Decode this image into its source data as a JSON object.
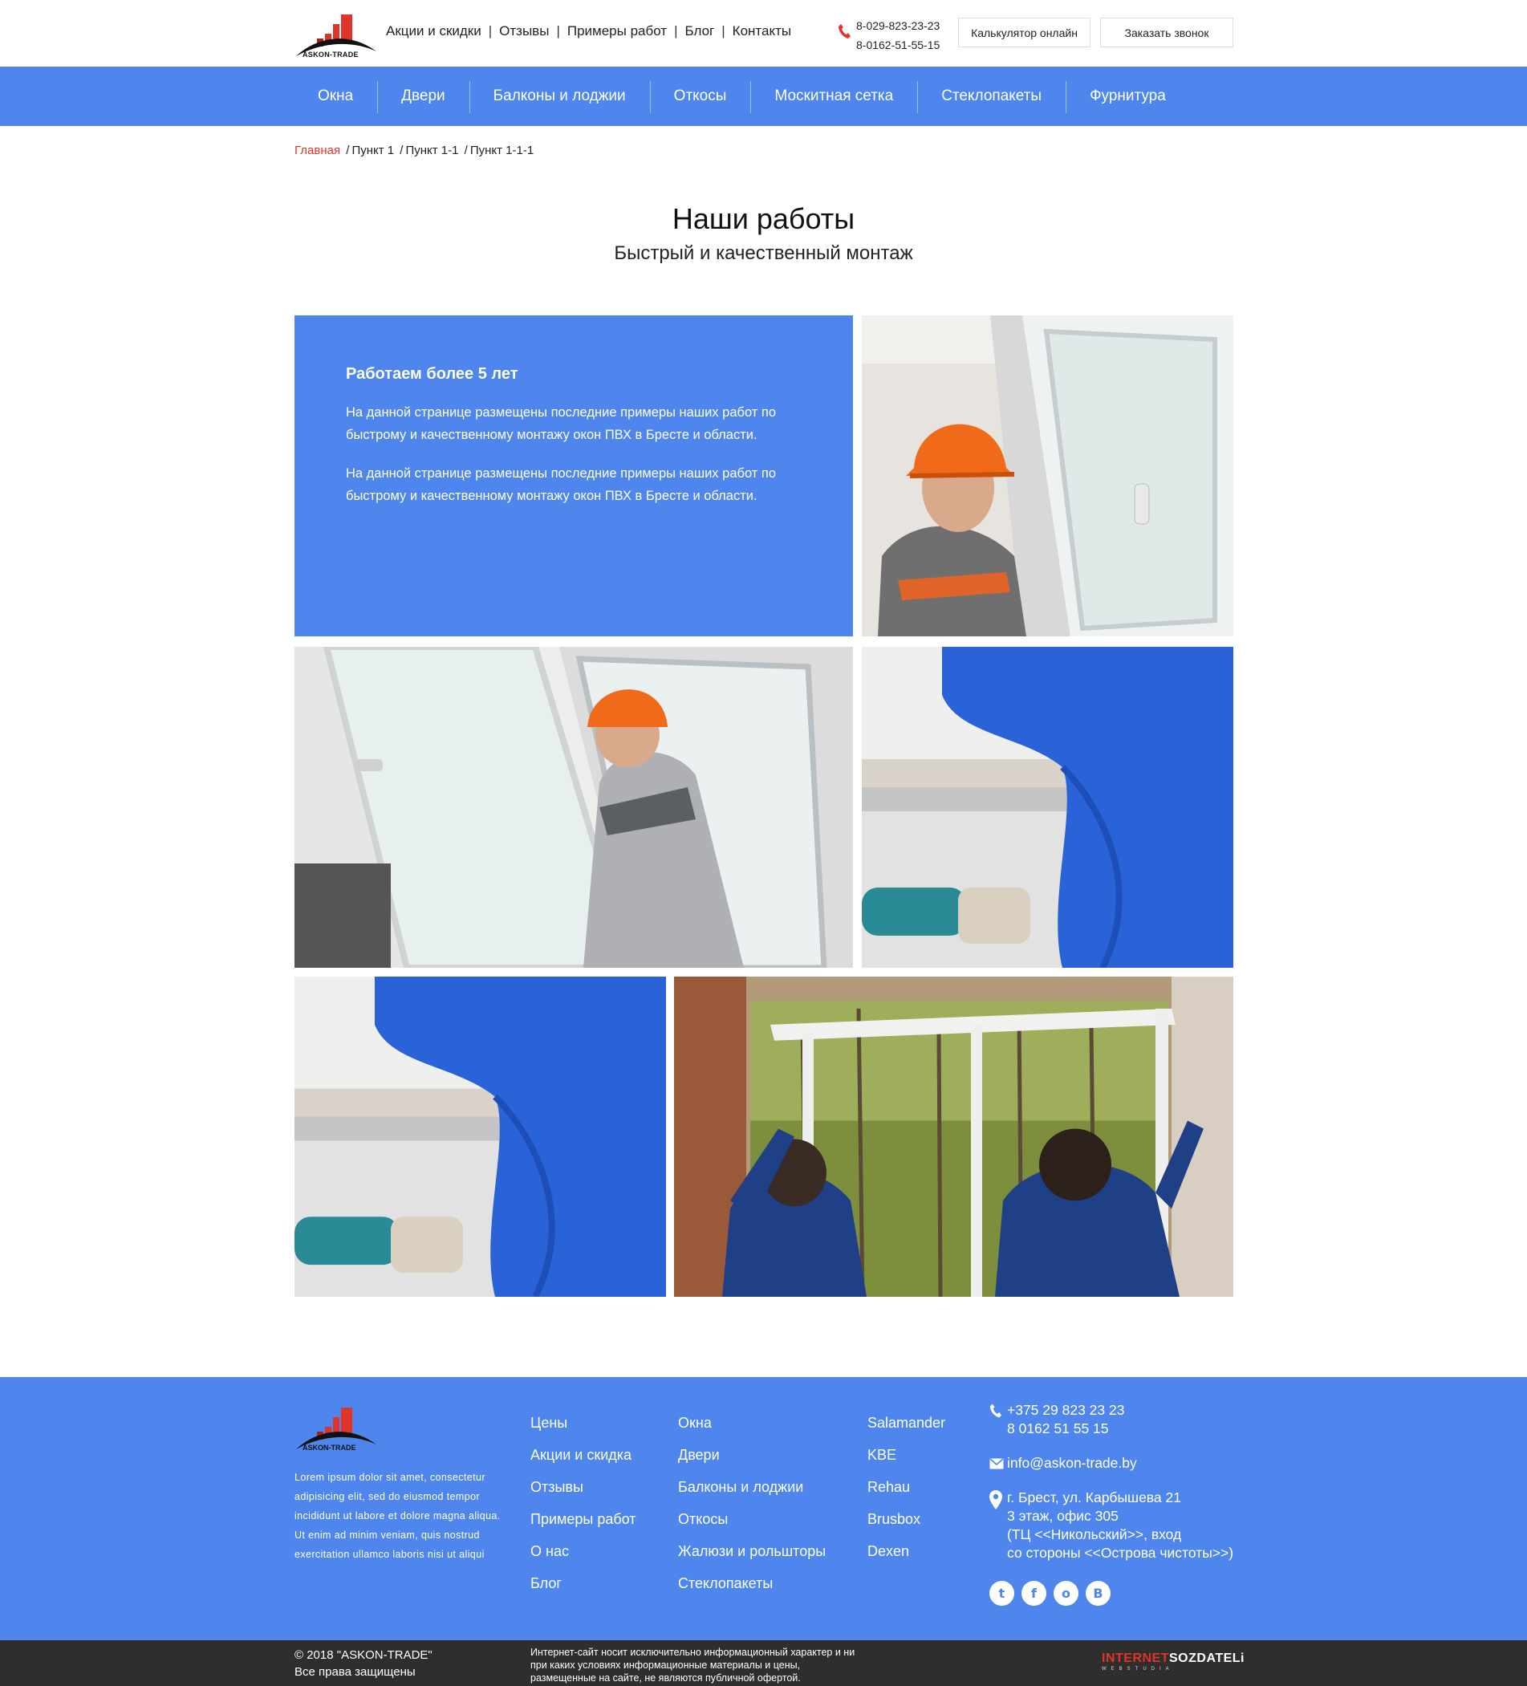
{
  "header": {
    "logo_text": "ASKON-TRADE",
    "topnav": [
      "Акции и скидки",
      "Отзывы",
      "Примеры работ",
      "Блог",
      "Контакты"
    ],
    "phones": [
      "8-029-823-23-23",
      "8-0162-51-55-15"
    ],
    "calc_button": "Калькулятор онлайн",
    "call_button": "Заказать звонок"
  },
  "mainnav": [
    "Окна",
    "Двери",
    "Балконы и лоджии",
    "Откосы",
    "Москитная сетка",
    "Стеклопакеты",
    "Фурнитура"
  ],
  "breadcrumb": {
    "home": "Главная",
    "items": [
      "Пункт 1",
      "Пункт 1-1",
      "Пункт 1-1-1"
    ],
    "separator": "/"
  },
  "page": {
    "title": "Наши работы",
    "subtitle": "Быстрый и качественный монтаж"
  },
  "intro": {
    "heading": "Работаем более 5 лет",
    "paragraphs": [
      "На данной странице размещены последние примеры наших работ по быстрому и качественному монтажу окон ПВХ в Бресте и области.",
      "На данной странице размещены последние примеры наших работ по быстрому и качественному монтажу окон ПВХ в Бресте и области."
    ]
  },
  "footer": {
    "logo_text": "ASKON-TRADE",
    "description": "Lorem ipsum dolor sit amet, consectetur adipisicing elit, sed do eiusmod tempor incididunt ut labore et dolore magna aliqua. Ut enim ad minim veniam, quis nostrud exercitation ullamco laboris nisi ut aliqui",
    "col1": [
      "Цены",
      "Акции и скидка",
      "Отзывы",
      "Примеры работ",
      "О нас",
      "Блог"
    ],
    "col2": [
      "Окна",
      "Двери",
      "Балконы и лоджии",
      "Откосы",
      "Жалюзи и рольшторы",
      "Стеклопакеты"
    ],
    "col3": [
      "Salamander",
      "KBE",
      "Rehau",
      "Brusbox",
      "Dexen"
    ],
    "phones": [
      "+375 29 823 23 23",
      "8 0162 51 55 15"
    ],
    "email": "info@askon-trade.by",
    "address": [
      "г. Брест, ул. Карбышева 21",
      "3 этаж, офис 305",
      "(ТЦ <<Никольский>>, вход",
      "со стороны <<Острова чистоты>>)"
    ],
    "socials": [
      {
        "icon": "twitter-icon",
        "glyph": "t"
      },
      {
        "icon": "facebook-icon",
        "glyph": "f"
      },
      {
        "icon": "odnoklassniki-icon",
        "glyph": "o"
      },
      {
        "icon": "vk-icon",
        "glyph": "B"
      }
    ]
  },
  "bottombar": {
    "copyright": "© 2018 \"ASKON-TRADE\"",
    "rights": "Все права защищены",
    "disclaimer": "Интернет-сайт носит исключительно информационный характер и ни при каких условиях информационные материалы и цены, размещенные на сайте, не являются публичной офертой.",
    "studio_red": "INTERNET",
    "studio_white": "SOZDATELi",
    "studio_sub": "WEBSTUDIA"
  },
  "colors": {
    "accent": "#4f86ee",
    "red": "#e0342a",
    "dark": "#2e2e2e"
  }
}
